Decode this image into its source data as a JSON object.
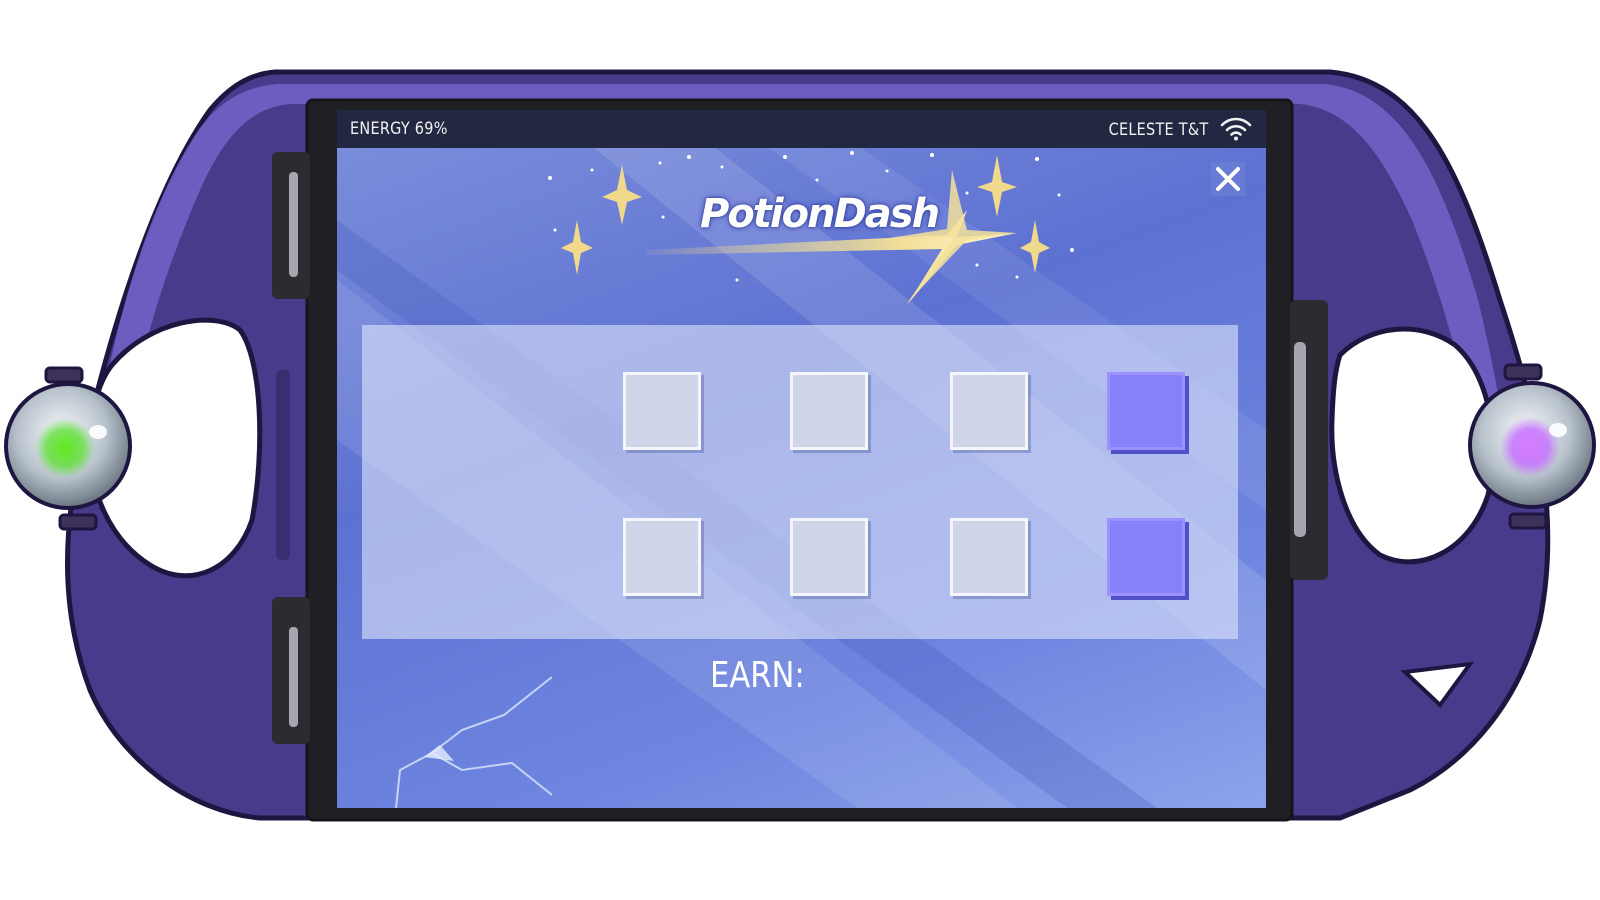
{
  "status_bar": {
    "energy": "ENERGY 69%",
    "carrier": "CELESTE T&T",
    "wifi_icon": "wifi-icon"
  },
  "close_icon": "close-icon",
  "logo": {
    "text": "PotionDash",
    "sparkle_color": "#f0d98a"
  },
  "slots": {
    "rows": [
      [
        "empty",
        "empty",
        "empty",
        "filled"
      ],
      [
        "empty",
        "empty",
        "empty",
        "filled"
      ]
    ]
  },
  "earn": {
    "label": "EARN:",
    "value": ""
  },
  "device": {
    "left_orb": {
      "icon": "green-gem-icon",
      "color": "#5fe03a"
    },
    "right_orb": {
      "icon": "purple-gem-icon",
      "color": "#c36bff"
    },
    "body_color": "#4c3a8e"
  }
}
